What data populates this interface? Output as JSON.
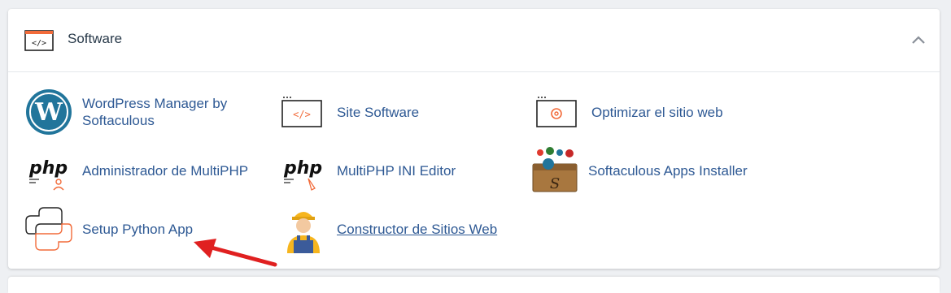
{
  "section": {
    "title": "Software",
    "icon": "code-window-icon",
    "collapse_icon": "chevron-up-icon"
  },
  "items": [
    {
      "label": "WordPress Manager by Softaculous",
      "icon": "wordpress-icon"
    },
    {
      "label": "Site Software",
      "icon": "code-window-icon"
    },
    {
      "label": "Optimizar el sitio web",
      "icon": "gear-window-icon"
    },
    {
      "label": "Administrador de MultiPHP",
      "icon": "php-user-icon"
    },
    {
      "label": "MultiPHP INI Editor",
      "icon": "php-pen-icon"
    },
    {
      "label": "Softaculous Apps Installer",
      "icon": "softaculous-box-icon"
    },
    {
      "label": "Setup Python App",
      "icon": "python-icon"
    },
    {
      "label": "Constructor de Sitios Web",
      "icon": "worker-icon"
    }
  ],
  "colors": {
    "link": "#2e5994",
    "accent": "#f26b3a",
    "annotation_arrow": "#e02020"
  }
}
